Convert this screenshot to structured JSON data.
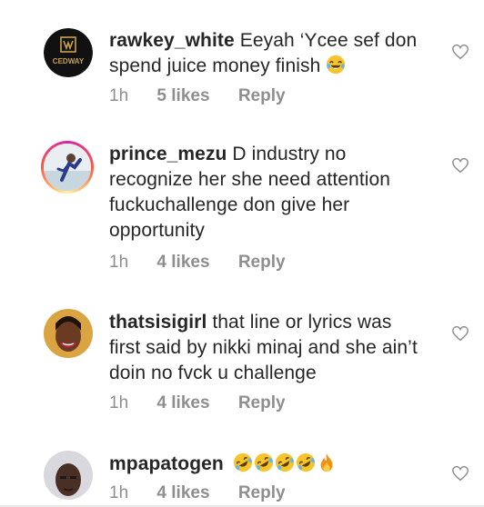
{
  "comments": [
    {
      "username": "rawkey_white",
      "text": "Eeyah ‘Ycee sef don spend juice money finish",
      "emoji": "laughing-tears-emoji",
      "time": "1h",
      "likes": "5 likes",
      "reply": "Reply",
      "avatar_text": "CEDWAY"
    },
    {
      "username": "prince_mezu",
      "text": "D industry no recognize her she need attention fuckuchallenge  don give her opportunity",
      "time": "1h",
      "likes": "4 likes",
      "reply": "Reply"
    },
    {
      "username": "thatsisigirl",
      "text": "that line or lyrics was first said by nikki minaj and she ain’t doin no fvck u challenge",
      "time": "1h",
      "likes": "4 likes",
      "reply": "Reply"
    },
    {
      "username": "mpapatogen",
      "emojis": [
        "rofl-emoji",
        "rofl-emoji",
        "rofl-emoji",
        "rofl-emoji",
        "fire-emoji"
      ],
      "time": "1h",
      "likes": "4 likes",
      "reply": "Reply"
    }
  ],
  "colors": {
    "text": "#262626",
    "meta": "#8e8e8e",
    "heart_outline": "#8e8e8e",
    "emoji_yellow": "#f7c52b",
    "story_ring": "#d6249f"
  }
}
